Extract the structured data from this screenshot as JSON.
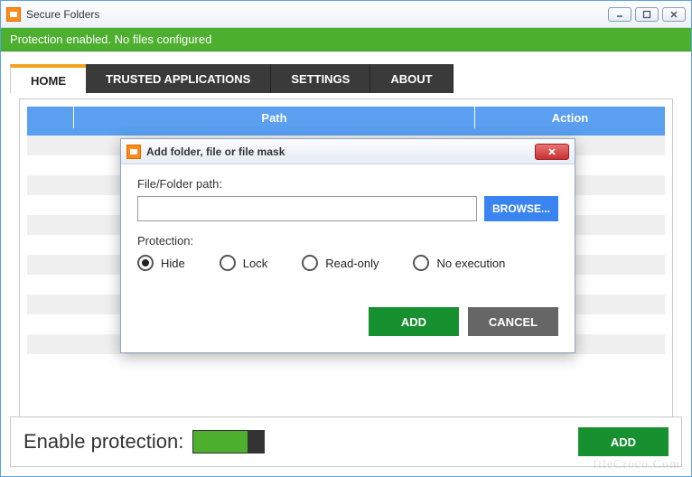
{
  "window": {
    "title": "Secure Folders"
  },
  "status": "Protection enabled. No files configured",
  "tabs": {
    "home": "HOME",
    "trusted": "TRUSTED APPLICATIONS",
    "settings": "SETTINGS",
    "about": "ABOUT"
  },
  "table": {
    "col_path": "Path",
    "col_action": "Action"
  },
  "bottom": {
    "enable_label": "Enable protection:",
    "add": "ADD"
  },
  "dialog": {
    "title": "Add folder, file or file mask",
    "path_label": "File/Folder path:",
    "path_value": "",
    "browse": "BROWSE...",
    "protection_label": "Protection:",
    "options": {
      "hide": "Hide",
      "lock": "Lock",
      "readonly": "Read-only",
      "noexec": "No execution"
    },
    "add": "ADD",
    "cancel": "CANCEL"
  },
  "watermark": "fileCroco.Com"
}
